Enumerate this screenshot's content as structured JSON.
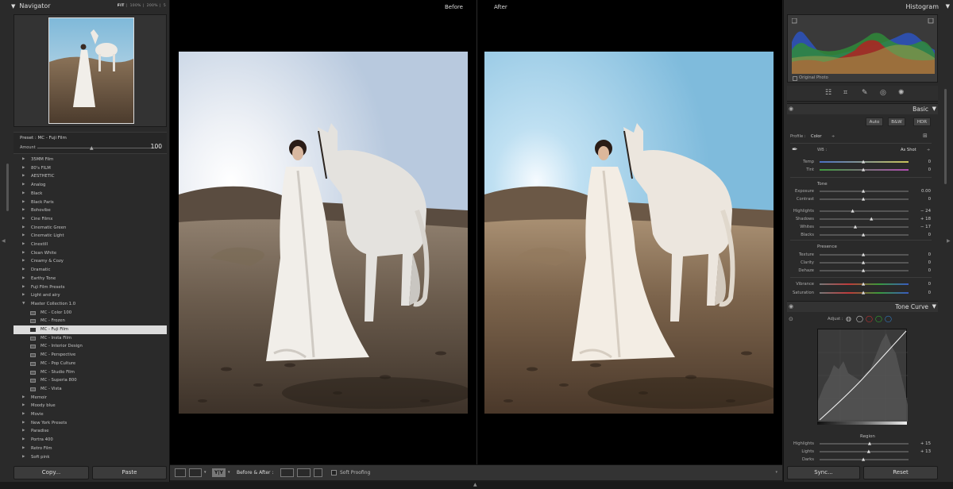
{
  "navigator": {
    "title": "Navigator",
    "zoom_options": [
      "FIT",
      "100%",
      "200%",
      "5"
    ],
    "active_zoom": "FIT"
  },
  "preset_info": {
    "preset_label": "Preset : MC - Fuji Film",
    "amount_label": "Amount",
    "amount_value": "100",
    "amount_level": 1.0
  },
  "presets": [
    {
      "label": "35MM Film",
      "type": "folder"
    },
    {
      "label": "80's FILM",
      "type": "folder"
    },
    {
      "label": "AESTHETIC",
      "type": "folder"
    },
    {
      "label": "Analog",
      "type": "folder"
    },
    {
      "label": "Black",
      "type": "folder"
    },
    {
      "label": "Black Paris",
      "type": "folder"
    },
    {
      "label": "Bohovibe",
      "type": "folder"
    },
    {
      "label": "Cine Filmx",
      "type": "folder"
    },
    {
      "label": "Cinematic Green",
      "type": "folder"
    },
    {
      "label": "Cinematic Light",
      "type": "folder"
    },
    {
      "label": "Cinestill",
      "type": "folder"
    },
    {
      "label": "Clean White",
      "type": "folder"
    },
    {
      "label": "Creamy & Cozy",
      "type": "folder"
    },
    {
      "label": "Dramatic",
      "type": "folder"
    },
    {
      "label": "Earthy Tone",
      "type": "folder"
    },
    {
      "label": "Fuji Film Presets",
      "type": "folder"
    },
    {
      "label": "Light and airy",
      "type": "folder"
    },
    {
      "label": "Master Collection 1.0",
      "type": "open-folder"
    },
    {
      "label": "MC - Color 100",
      "type": "child"
    },
    {
      "label": "MC - Frozen",
      "type": "child"
    },
    {
      "label": "MC - Fuji Film",
      "type": "child",
      "selected": true
    },
    {
      "label": "MC - Insta Film",
      "type": "child"
    },
    {
      "label": "MC - Interior Design",
      "type": "child"
    },
    {
      "label": "MC - Perspective",
      "type": "child"
    },
    {
      "label": "MC - Pop Culture",
      "type": "child"
    },
    {
      "label": "MC - Studio Film",
      "type": "child"
    },
    {
      "label": "MC - Superia 800",
      "type": "child"
    },
    {
      "label": "MC - Vista",
      "type": "child"
    },
    {
      "label": "Memoir",
      "type": "folder"
    },
    {
      "label": "Moody blue",
      "type": "folder"
    },
    {
      "label": "Movie",
      "type": "folder"
    },
    {
      "label": "New York Presets",
      "type": "folder"
    },
    {
      "label": "Paradise",
      "type": "folder"
    },
    {
      "label": "Portra 400",
      "type": "folder"
    },
    {
      "label": "Retro Film",
      "type": "folder"
    },
    {
      "label": "Soft pink",
      "type": "folder"
    }
  ],
  "left_buttons": {
    "copy": "Copy...",
    "paste": "Paste"
  },
  "view": {
    "before_label": "Before",
    "after_label": "After"
  },
  "toolbar": {
    "yy_label": "Y|Y",
    "before_after_label": "Before & After :",
    "soft_proofing_label": "Soft Proofing"
  },
  "histogram": {
    "title": "Histogram",
    "original_photo_label": "Original Photo"
  },
  "basic": {
    "title": "Basic",
    "modes": [
      "Auto",
      "B&W",
      "HDR"
    ],
    "profile_label": "Profile :",
    "profile_value": "Color",
    "wb_label": "WB :",
    "wb_value": "As Shot",
    "tone_label": "Tone",
    "presence_label": "Presence",
    "sliders": [
      {
        "name": "Temp",
        "value": "0",
        "level": 0.5
      },
      {
        "name": "Tint",
        "value": "0",
        "level": 0.5
      },
      {
        "name": "Exposure",
        "value": "0.00",
        "level": 0.5
      },
      {
        "name": "Contrast",
        "value": "0",
        "level": 0.5
      },
      {
        "name": "Highlights",
        "value": "− 24",
        "level": 0.38
      },
      {
        "name": "Shadows",
        "value": "+ 18",
        "level": 0.59
      },
      {
        "name": "Whites",
        "value": "− 17",
        "level": 0.41
      },
      {
        "name": "Blacks",
        "value": "0",
        "level": 0.5
      },
      {
        "name": "Texture",
        "value": "0",
        "level": 0.5
      },
      {
        "name": "Clarity",
        "value": "0",
        "level": 0.5
      },
      {
        "name": "Dehaze",
        "value": "0",
        "level": 0.5
      },
      {
        "name": "Vibrance",
        "value": "0",
        "level": 0.5
      },
      {
        "name": "Saturation",
        "value": "0",
        "level": 0.5
      }
    ]
  },
  "tone_curve": {
    "title": "Tone Curve",
    "adjust_label": "Adjust :",
    "region_label": "Region",
    "sliders": [
      {
        "name": "Highlights",
        "value": "+ 15",
        "level": 0.57
      },
      {
        "name": "Lights",
        "value": "+ 13",
        "level": 0.56
      },
      {
        "name": "Darks",
        "value": "",
        "level": 0.5
      }
    ]
  },
  "right_buttons": {
    "sync": "Sync...",
    "reset": "Reset"
  },
  "colors": {
    "sky_before": "#c9d6e6",
    "sky_after": "#8ec3e2",
    "sand": "#6a5846",
    "selected_row": "#dcdcdc"
  }
}
